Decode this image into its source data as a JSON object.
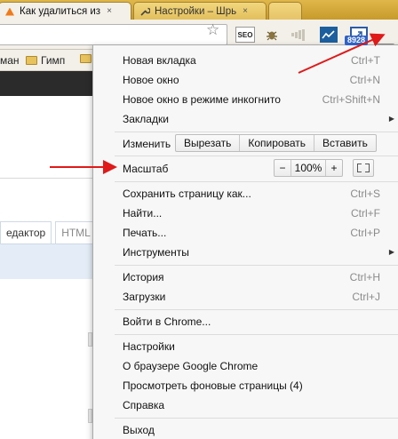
{
  "tabs": [
    {
      "title": "Как удалиться из",
      "close": "×"
    },
    {
      "title": "Настройки – Шрь",
      "close": "×"
    }
  ],
  "toolbar": {
    "seo_label": "SEO",
    "badge_count": "8928"
  },
  "bookmarks": [
    {
      "label": "ман"
    },
    {
      "label": "Гимп"
    }
  ],
  "page": {
    "editor_tab": "едактор",
    "html_tab": "HTML"
  },
  "menu": {
    "new_tab": {
      "label": "Новая вкладка",
      "shortcut": "Ctrl+T"
    },
    "new_window": {
      "label": "Новое окно",
      "shortcut": "Ctrl+N"
    },
    "incognito": {
      "label": "Новое окно в режиме инкогнито",
      "shortcut": "Ctrl+Shift+N"
    },
    "bookmarks": {
      "label": "Закладки"
    },
    "edit": {
      "label": "Изменить",
      "cut": "Вырезать",
      "copy": "Копировать",
      "paste": "Вставить"
    },
    "zoom": {
      "label": "Масштаб",
      "minus": "−",
      "value": "100%",
      "plus": "+"
    },
    "save_page": {
      "label": "Сохранить страницу как...",
      "shortcut": "Ctrl+S"
    },
    "find": {
      "label": "Найти...",
      "shortcut": "Ctrl+F"
    },
    "print": {
      "label": "Печать...",
      "shortcut": "Ctrl+P"
    },
    "tools": {
      "label": "Инструменты"
    },
    "history": {
      "label": "История",
      "shortcut": "Ctrl+H"
    },
    "downloads": {
      "label": "Загрузки",
      "shortcut": "Ctrl+J"
    },
    "sign_in": {
      "label": "Войти в Chrome..."
    },
    "settings": {
      "label": "Настройки"
    },
    "about": {
      "label": "О браузере Google Chrome"
    },
    "background_pages": {
      "label": "Просмотреть фоновые страницы (4)"
    },
    "help": {
      "label": "Справка"
    },
    "exit": {
      "label": "Выход"
    }
  },
  "colors": {
    "arrow": "#e01919",
    "tabstrip": "#d9ae3e",
    "menu_bg": "#f7f7f7"
  }
}
